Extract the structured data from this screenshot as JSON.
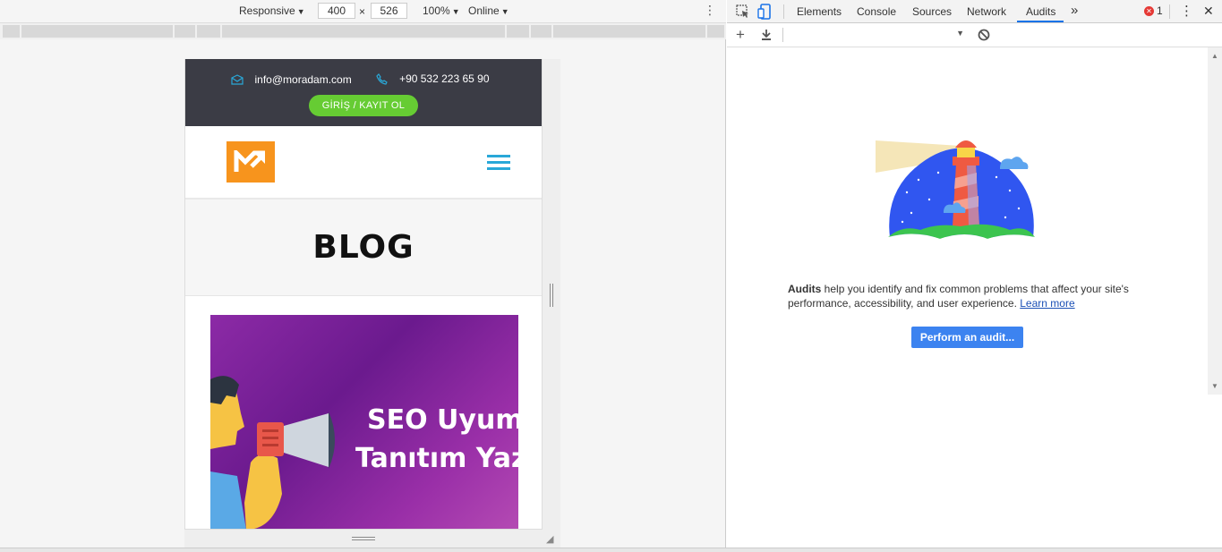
{
  "device_toolbar": {
    "device": "Responsive",
    "width": "400",
    "times": "×",
    "height": "526",
    "zoom": "100%",
    "network": "Online"
  },
  "site": {
    "email": "info@moradam.com",
    "phone": "+90 532 223 65 90",
    "login_label": "GİRİŞ / KAYIT OL",
    "page_title": "BLOG",
    "post_headline_1": "SEO Uyum",
    "post_headline_2": "Tanıtım Yaz"
  },
  "devtools": {
    "tabs": [
      "Elements",
      "Console",
      "Sources",
      "Network",
      "Audits"
    ],
    "active_tab": "Audits",
    "more_tabs": "»",
    "error_count": "1",
    "audits": {
      "desc_bold": "Audits",
      "desc_text": " help you identify and fix common problems that affect your site's performance, accessibility, and user experience. ",
      "learn_more": "Learn more",
      "perform_button": "Perform an audit..."
    }
  },
  "colors": {
    "accent": "#1a73e8",
    "button": "#3c83f0",
    "login_green": "#66cc33",
    "logo_orange": "#f7941d",
    "hamburger": "#29a8d8"
  }
}
